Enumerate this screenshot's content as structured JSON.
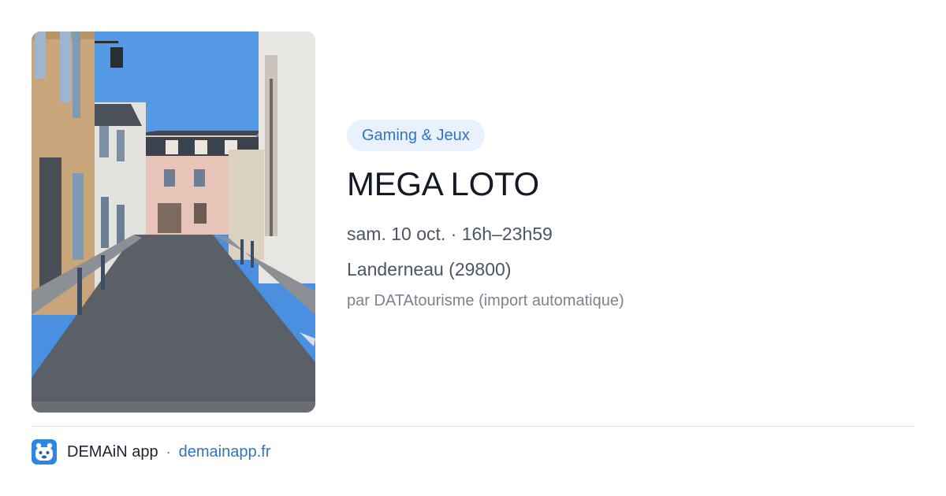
{
  "event": {
    "category": "Gaming & Jeux",
    "title": "MEGA LOTO",
    "date_time": "sam. 10 oct. · 16h–23h59",
    "location": "Landerneau (29800)",
    "source": "par DATAtourisme (import automatique)"
  },
  "footer": {
    "app_name": "DEMAiN app",
    "separator": "·",
    "url": "demainapp.fr"
  },
  "colors": {
    "accent": "#2f74c6",
    "badge_bg": "#e9f2fc",
    "logo": "#2b86e6"
  },
  "icons": {
    "app_logo": "demain-app-logo-icon"
  }
}
